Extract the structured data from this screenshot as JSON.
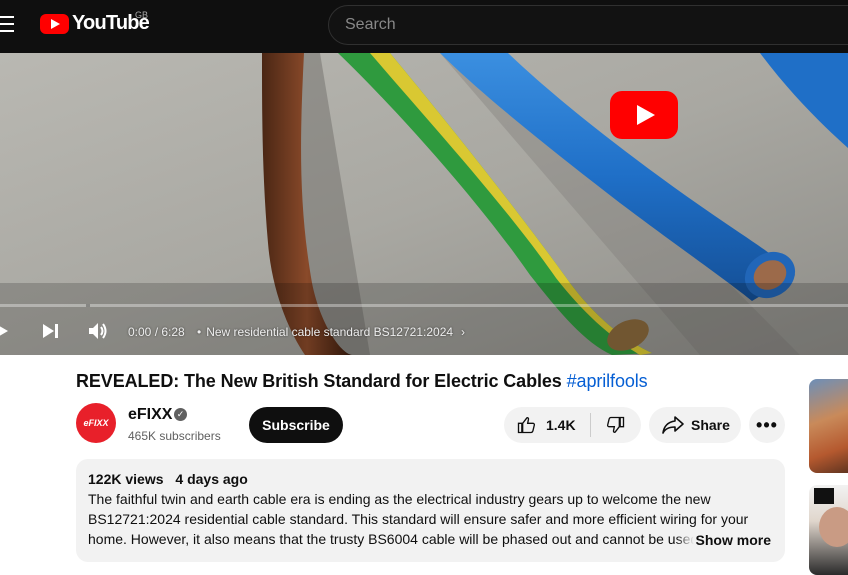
{
  "header": {
    "logo_text": "YouTube",
    "region": "GB",
    "search_placeholder": "Search"
  },
  "player": {
    "time": "0:00 / 6:28",
    "chapter": "New residential cable standard BS12721:2024",
    "progress": 0
  },
  "video": {
    "title": "REVEALED: The New British Standard for Electric Cables",
    "hashtag": "#aprilfools"
  },
  "channel": {
    "name": "eFIXX",
    "avatar_text": "eFIXX",
    "subscribers": "465K subscribers",
    "subscribe_label": "Subscribe"
  },
  "actions": {
    "likes": "1.4K",
    "share_label": "Share",
    "more_label": "•••"
  },
  "description": {
    "views": "122K views",
    "age": "4 days ago",
    "text": "The faithful twin and earth cable era is ending as the electrical industry gears up to welcome the new BS12721:2024 residential cable standard. This standard will ensure safer and more efficient wiring for your home. However, it also means that the trusty BS6004 cable will be phased out and cannot be used",
    "show_more": "Show more"
  },
  "colors": {
    "brand_red": "#ff0000",
    "link_blue": "#065fd4",
    "topbar": "#0f0f0f"
  }
}
